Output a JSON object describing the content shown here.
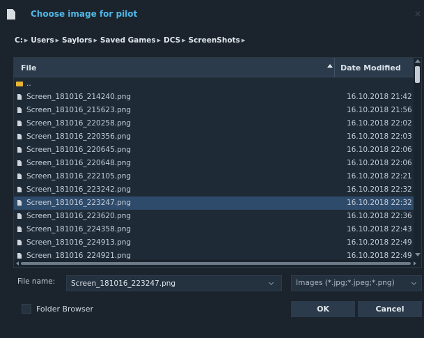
{
  "dialog": {
    "title": "Choose image for pilot"
  },
  "breadcrumb": [
    "C:",
    "Users",
    "Saylors",
    "Saved Games",
    "DCS",
    "ScreenShots"
  ],
  "table": {
    "columns": {
      "file": "File",
      "date": "Date Modified"
    },
    "parent_label": "..",
    "rows": [
      {
        "name": "Screen_181016_214240.png",
        "date": "16.10.2018 21:42"
      },
      {
        "name": "Screen_181016_215623.png",
        "date": "16.10.2018 21:56"
      },
      {
        "name": "Screen_181016_220258.png",
        "date": "16.10.2018 22:02"
      },
      {
        "name": "Screen_181016_220356.png",
        "date": "16.10.2018 22:03"
      },
      {
        "name": "Screen_181016_220645.png",
        "date": "16.10.2018 22:06"
      },
      {
        "name": "Screen_181016_220648.png",
        "date": "16.10.2018 22:06"
      },
      {
        "name": "Screen_181016_222105.png",
        "date": "16.10.2018 22:21"
      },
      {
        "name": "Screen_181016_223242.png",
        "date": "16.10.2018 22:32"
      },
      {
        "name": "Screen_181016_223247.png",
        "date": "16.10.2018 22:32",
        "selected": true
      },
      {
        "name": "Screen_181016_223620.png",
        "date": "16.10.2018 22:36"
      },
      {
        "name": "Screen_181016_224358.png",
        "date": "16.10.2018 22:43"
      },
      {
        "name": "Screen_181016_224913.png",
        "date": "16.10.2018 22:49"
      },
      {
        "name": "Screen_181016_224921.png",
        "date": "16.10.2018 22:49"
      }
    ]
  },
  "file_name": {
    "label": "File name:",
    "value": "Screen_181016_223247.png"
  },
  "file_type": {
    "value": "Images (*.jpg;*.jpeg;*.png)"
  },
  "folder_browser": {
    "label": "Folder Browser",
    "checked": false
  },
  "buttons": {
    "ok": "OK",
    "cancel": "Cancel"
  },
  "colors": {
    "accent": "#4fb7e6",
    "selected_row": "#2f4b6b",
    "background": "#1b232c"
  }
}
